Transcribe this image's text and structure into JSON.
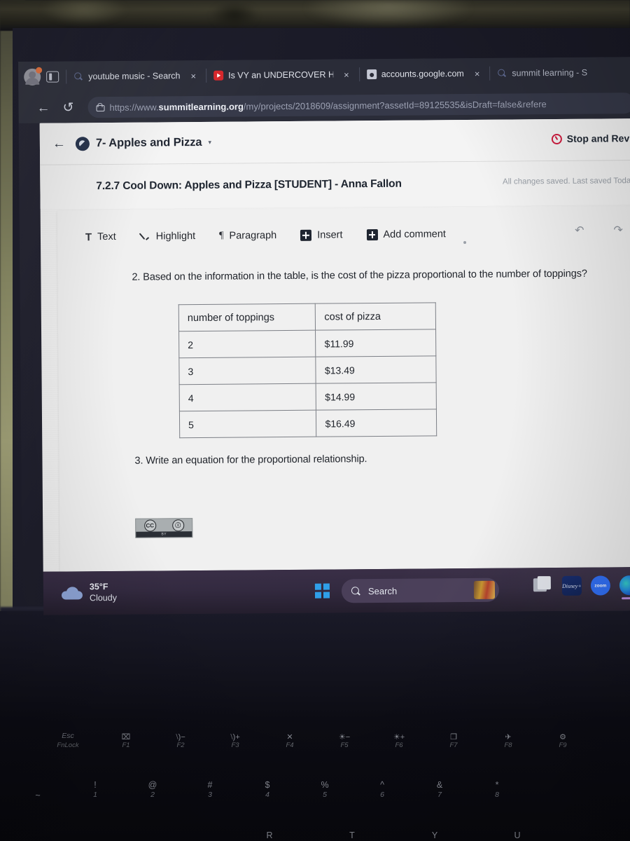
{
  "browser": {
    "profile_badge": "notification",
    "tabs": [
      {
        "favicon": "search-icon",
        "title": "youtube music - Search",
        "close": "×"
      },
      {
        "favicon": "youtube-icon",
        "title": "Is VY an UNDERCOVER H",
        "close": "×"
      },
      {
        "favicon": "page-icon",
        "title": "accounts.google.com",
        "close": "×"
      },
      {
        "favicon": "search-icon",
        "title": "summit learning - S",
        "close": ""
      }
    ],
    "back_label": "←",
    "reload_label": "↺",
    "url_prefix": "https://www.",
    "url_domain": "summitlearning.org",
    "url_path": "/my/projects/2018609/assignment?assetId=89125535&isDraft=false&refere"
  },
  "app": {
    "back_label": "←",
    "project_title": "7- Apples and Pizza",
    "project_caret": "▾",
    "stop_and_revise": "Stop and Revis",
    "assignment_title": "7.2.7 Cool Down: Apples and Pizza [STUDENT] - Anna Fallon",
    "saved_status": "All changes saved. Last saved Today,"
  },
  "toolbar": {
    "text_label": "Text",
    "text_icon": "T",
    "highlight_label": "Highlight",
    "paragraph_label": "Paragraph",
    "paragraph_icon": "¶",
    "insert_label": "Insert",
    "add_comment_label": "Add comment",
    "undo_label": "↶",
    "redo_label": "↷"
  },
  "document": {
    "question_2": "2. Based on the information in the table, is the cost of the pizza proportional to the number of toppings?",
    "question_3": "3. Write an equation for the proportional relationship.",
    "license": {
      "cc": "CC",
      "by_symbol": "ⓘ",
      "footer": "BY"
    }
  },
  "chart_data": {
    "type": "table",
    "title": "",
    "columns": [
      "number of toppings",
      "cost of pizza"
    ],
    "categories": [
      "2",
      "3",
      "4",
      "5"
    ],
    "values": [
      11.99,
      13.49,
      14.99,
      16.49
    ],
    "rows": [
      [
        "2",
        "$11.99"
      ],
      [
        "3",
        "$13.49"
      ],
      [
        "4",
        "$14.99"
      ],
      [
        "5",
        "$16.49"
      ]
    ],
    "xlabel": "number of toppings",
    "ylabel": "cost of pizza"
  },
  "taskbar": {
    "weather_temp": "35°F",
    "weather_cond": "Cloudy",
    "start_label": "windows-start",
    "search_placeholder": "Search",
    "apps": [
      {
        "name": "task-view",
        "label": ""
      },
      {
        "name": "disney",
        "label": "Disney+"
      },
      {
        "name": "zoom",
        "label": "zoom"
      },
      {
        "name": "edge",
        "label": ""
      },
      {
        "name": "file-explorer",
        "label": ""
      }
    ]
  },
  "keyboard": {
    "fn_row": [
      {
        "sym": "",
        "lbl": "Esc",
        "sub": "FnLock",
        "fn": ""
      },
      {
        "sym": "⌧",
        "lbl": "",
        "sub": "",
        "fn": "F1"
      },
      {
        "sym": "⧵)−",
        "lbl": "",
        "sub": "",
        "fn": "F2"
      },
      {
        "sym": "⧵)+",
        "lbl": "",
        "sub": "",
        "fn": "F3"
      },
      {
        "sym": "✕",
        "lbl": "",
        "sub": "",
        "fn": "F4"
      },
      {
        "sym": "☀−",
        "lbl": "",
        "sub": "",
        "fn": "F5"
      },
      {
        "sym": "☀+",
        "lbl": "",
        "sub": "",
        "fn": "F6"
      },
      {
        "sym": "❐",
        "lbl": "",
        "sub": "",
        "fn": "F7"
      },
      {
        "sym": "✈",
        "lbl": "",
        "sub": "",
        "fn": "F8"
      },
      {
        "sym": "⚙",
        "lbl": "",
        "sub": "",
        "fn": "F9"
      }
    ],
    "num_row": [
      {
        "top": "~",
        "bot": ""
      },
      {
        "top": "!",
        "bot": "1"
      },
      {
        "top": "@",
        "bot": "2"
      },
      {
        "top": "#",
        "bot": "3"
      },
      {
        "top": "$",
        "bot": "4"
      },
      {
        "top": "%",
        "bot": "5"
      },
      {
        "top": "^",
        "bot": "6"
      },
      {
        "top": "&",
        "bot": "7"
      },
      {
        "top": "*",
        "bot": "8"
      }
    ],
    "letter_row": [
      "R",
      "T",
      "Y",
      "U"
    ]
  },
  "colors": {
    "chrome_bg": "#2a2c38",
    "page_bg": "#f3f3f3",
    "taskbar_bg": "#3a2f47",
    "accent_red": "#d01c3f",
    "accent_blue": "#2f9fe8"
  }
}
